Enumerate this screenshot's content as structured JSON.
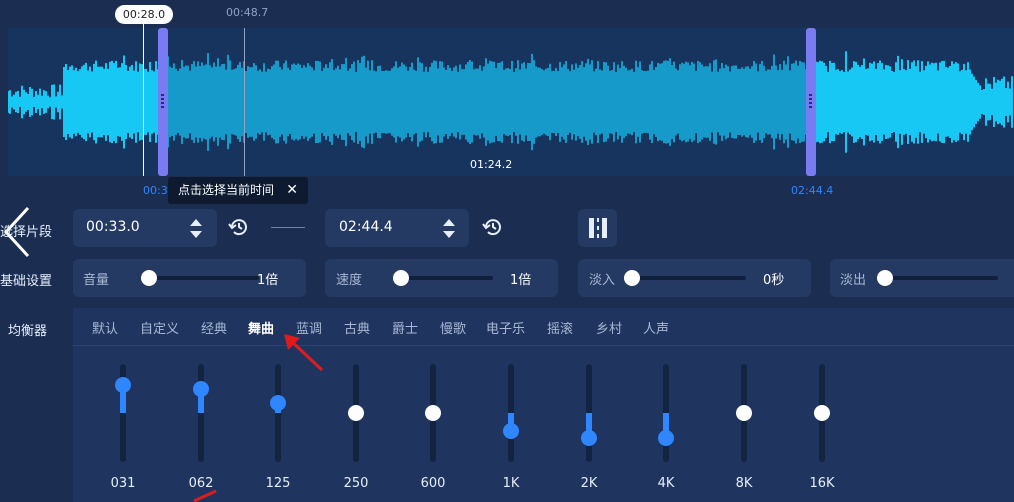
{
  "waveform": {
    "playhead_bubble": "00:28.0",
    "hover_time": "00:48.7",
    "center_time": "01:24.2",
    "start_marker": "00:33.0",
    "end_marker": "02:44.4"
  },
  "tooltip": {
    "text": "点击选择当前时间",
    "close": "✕"
  },
  "nav": {
    "back_icon": "chevron-left-icon"
  },
  "segment": {
    "label": "选择片段",
    "start_value": "00:33.0",
    "end_value": "02:44.4"
  },
  "basic": {
    "label": "基础设置",
    "volume_label": "音量",
    "volume_value": "1倍",
    "volume_level": 0.07,
    "speed_label": "速度",
    "speed_value": "1倍",
    "speed_level": 0.07,
    "fadein_label": "淡入",
    "fadein_value": "0秒",
    "fadein_level": 0,
    "fadeout_label": "淡出",
    "fadeout_level": 0
  },
  "equalizer": {
    "label": "均衡器",
    "tabs": [
      "默认",
      "自定义",
      "经典",
      "舞曲",
      "蓝调",
      "古典",
      "爵士",
      "慢歌",
      "电子乐",
      "摇滚",
      "乡村",
      "人声"
    ],
    "active_tab": "舞曲",
    "bands": [
      {
        "label": "031",
        "level": 0.29
      },
      {
        "label": "062",
        "level": 0.25
      },
      {
        "label": "125",
        "level": 0.1
      },
      {
        "label": "250",
        "level": 0
      },
      {
        "label": "600",
        "level": 0
      },
      {
        "label": "1K",
        "level": -0.18
      },
      {
        "label": "2K",
        "level": -0.26
      },
      {
        "label": "4K",
        "level": -0.26
      },
      {
        "label": "8K",
        "level": 0
      },
      {
        "label": "16K",
        "level": 0
      }
    ]
  },
  "colors": {
    "accent": "#2f86ff",
    "handle": "#7a7bf2",
    "wave": "#17c8f5"
  }
}
